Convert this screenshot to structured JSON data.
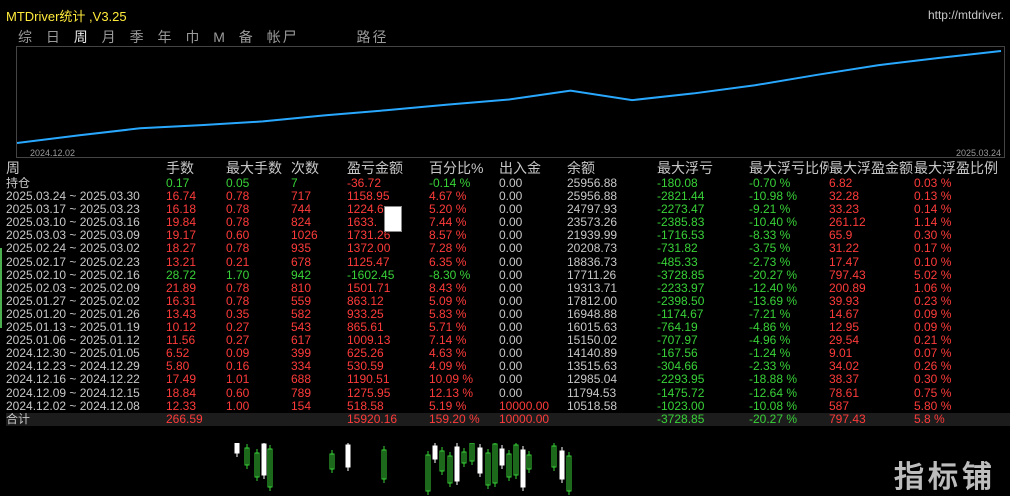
{
  "app": {
    "title": "MTDriver统计 ,V3.25",
    "url": "http://mtdriver."
  },
  "tabs": [
    "综",
    "日",
    "周",
    "月",
    "季",
    "年",
    "巾",
    "M",
    "备",
    "帐尸",
    "路径"
  ],
  "chart_data": {
    "type": "line",
    "x_start": "2024.12.02",
    "x_end": "2025.03.24",
    "series": [
      {
        "name": "",
        "values": [
          10518.58,
          11794.53,
          12985.04,
          13515.63,
          14140.89,
          15150.02,
          16015.63,
          16948.88,
          17812.0,
          19313.71,
          17711.26,
          18836.73,
          20208.73,
          21939.99,
          23573.26,
          24797.93,
          25956.88
        ]
      }
    ],
    "color": "#29a8ff"
  },
  "table": {
    "headers": [
      "周",
      "手数",
      "最大手数",
      "次数",
      "盈亏金额",
      "百分比%",
      "出入金",
      "余额",
      "最大浮亏",
      "最大浮亏比例",
      "最大浮盈金额",
      "最大浮盈比例"
    ],
    "rows": [
      [
        "持仓",
        "0.17",
        "0.05",
        "7",
        "-36.72",
        "-0.14 %",
        "0.00",
        "25956.88",
        "-180.08",
        "-0.70 %",
        "6.82",
        "0.03 %"
      ],
      [
        "2025.03.24 ~ 2025.03.30",
        "16.74",
        "0.78",
        "717",
        "1158.95",
        "4.67 %",
        "0.00",
        "25956.88",
        "-2821.44",
        "-10.98 %",
        "32.28",
        "0.13 %"
      ],
      [
        "2025.03.17 ~ 2025.03.23",
        "16.18",
        "0.78",
        "744",
        "1224.6",
        "5.20 %",
        "0.00",
        "24797.93",
        "-2273.47",
        "-9.21 %",
        "33.23",
        "0.14 %"
      ],
      [
        "2025.03.10 ~ 2025.03.16",
        "19.84",
        "0.78",
        "824",
        "1633.",
        "7.44 %",
        "0.00",
        "23573.26",
        "-2385.83",
        "-10.40 %",
        "261.12",
        "1.14 %"
      ],
      [
        "2025.03.03 ~ 2025.03.09",
        "19.17",
        "0.60",
        "1026",
        "1731.26",
        "8.57 %",
        "0.00",
        "21939.99",
        "-1716.53",
        "-8.33 %",
        "65.9",
        "0.30 %"
      ],
      [
        "2025.02.24 ~ 2025.03.02",
        "18.27",
        "0.78",
        "935",
        "1372.00",
        "7.28 %",
        "0.00",
        "20208.73",
        "-731.82",
        "-3.75 %",
        "31.22",
        "0.17 %"
      ],
      [
        "2025.02.17 ~ 2025.02.23",
        "13.21",
        "0.21",
        "678",
        "1125.47",
        "6.35 %",
        "0.00",
        "18836.73",
        "-485.33",
        "-2.73 %",
        "17.47",
        "0.10 %"
      ],
      [
        "2025.02.10 ~ 2025.02.16",
        "28.72",
        "1.70",
        "942",
        "-1602.45",
        "-8.30 %",
        "0.00",
        "17711.26",
        "-3728.85",
        "-20.27 %",
        "797.43",
        "5.02 %"
      ],
      [
        "2025.02.03 ~ 2025.02.09",
        "21.89",
        "0.78",
        "810",
        "1501.71",
        "8.43 %",
        "0.00",
        "19313.71",
        "-2233.97",
        "-12.40 %",
        "200.89",
        "1.06 %"
      ],
      [
        "2025.01.27 ~ 2025.02.02",
        "16.31",
        "0.78",
        "559",
        "863.12",
        "5.09 %",
        "0.00",
        "17812.00",
        "-2398.50",
        "-13.69 %",
        "39.93",
        "0.23 %"
      ],
      [
        "2025.01.20 ~ 2025.01.26",
        "13.43",
        "0.35",
        "582",
        "933.25",
        "5.83 %",
        "0.00",
        "16948.88",
        "-1174.67",
        "-7.21 %",
        "14.67",
        "0.09 %"
      ],
      [
        "2025.01.13 ~ 2025.01.19",
        "10.12",
        "0.27",
        "543",
        "865.61",
        "5.71 %",
        "0.00",
        "16015.63",
        "-764.19",
        "-4.86 %",
        "12.95",
        "0.09 %"
      ],
      [
        "2025.01.06 ~ 2025.01.12",
        "11.56",
        "0.27",
        "617",
        "1009.13",
        "7.14 %",
        "0.00",
        "15150.02",
        "-707.97",
        "-4.96 %",
        "29.54",
        "0.21 %"
      ],
      [
        "2024.12.30 ~ 2025.01.05",
        "6.52",
        "0.09",
        "399",
        "625.26",
        "4.63 %",
        "0.00",
        "14140.89",
        "-167.56",
        "-1.24 %",
        "9.01",
        "0.07 %"
      ],
      [
        "2024.12.23 ~ 2024.12.29",
        "5.80",
        "0.16",
        "334",
        "530.59",
        "4.09 %",
        "0.00",
        "13515.63",
        "-304.66",
        "-2.33 %",
        "34.02",
        "0.26 %"
      ],
      [
        "2024.12.16 ~ 2024.12.22",
        "17.49",
        "1.01",
        "688",
        "1190.51",
        "10.09 %",
        "0.00",
        "12985.04",
        "-2293.95",
        "-18.88 %",
        "38.37",
        "0.30 %"
      ],
      [
        "2024.12.09 ~ 2024.12.15",
        "18.84",
        "0.60",
        "789",
        "1275.95",
        "12.13 %",
        "0.00",
        "11794.53",
        "-1475.72",
        "-12.64 %",
        "78.61",
        "0.75 %"
      ],
      [
        "2024.12.02 ~ 2024.12.08",
        "12.33",
        "1.00",
        "154",
        "518.58",
        "5.19 %",
        "10000.00",
        "10518.58",
        "-1023.00",
        "-10.08 %",
        "587",
        "5.80 %"
      ]
    ],
    "total": [
      "合计",
      "266.59",
      "",
      "",
      "15920.16",
      "159.20 %",
      "10000.00",
      "",
      "-3728.85",
      "-20.27 %",
      "797.43",
      "5.8 %"
    ]
  },
  "watermark": "指标铺"
}
